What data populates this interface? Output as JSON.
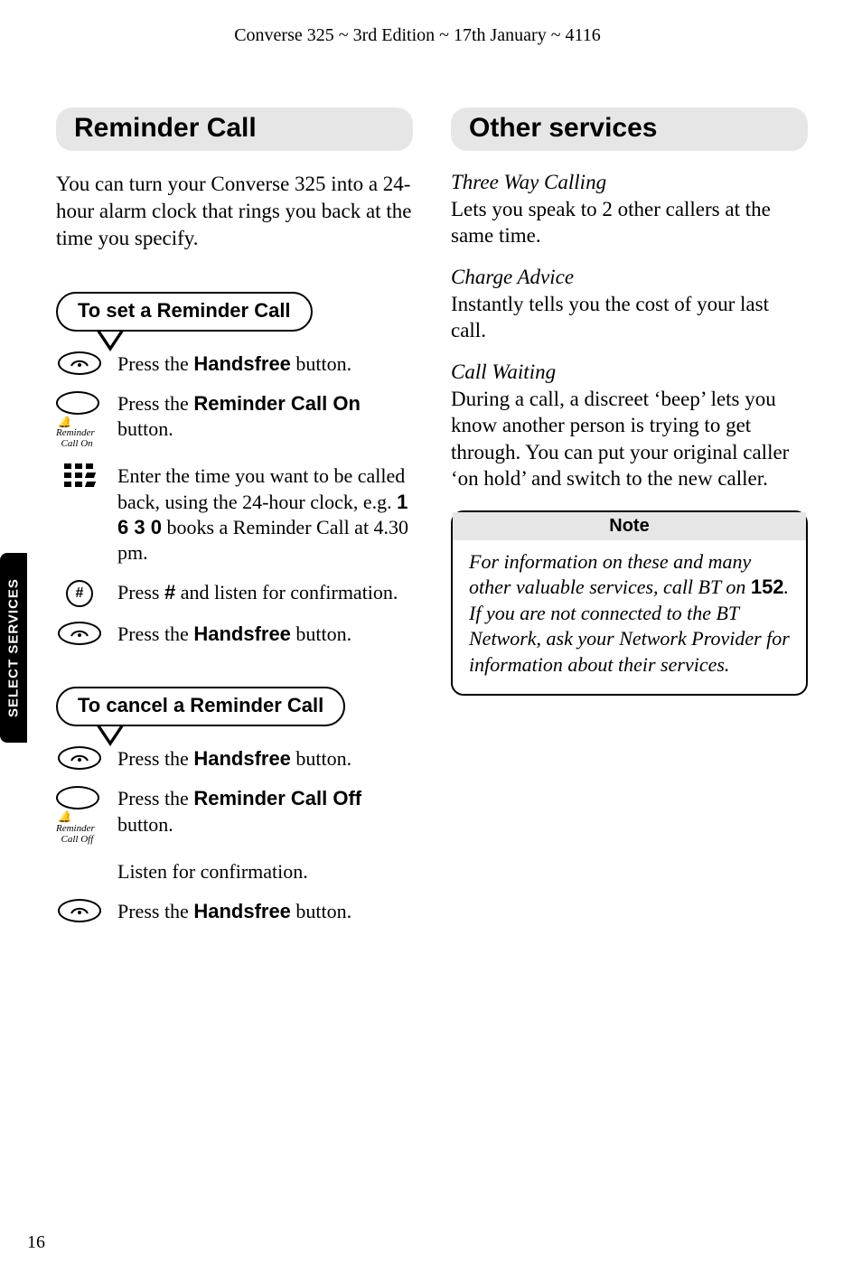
{
  "runningHead": "Converse 325 ~ 3rd Edition ~ 17th January ~ 4116",
  "sideTab": "SELECT SERVICES",
  "pageNumber": "16",
  "left": {
    "heading": "Reminder Call",
    "intro": "You can turn your Converse 325 into a 24-hour alarm clock that rings you back at the time you specify.",
    "set": {
      "title": "To set a Reminder Call",
      "steps": {
        "s1a": "Press the ",
        "s1b": "Handsfree",
        "s1c": " button.",
        "s2a": "Press the ",
        "s2b": "Reminder Call On",
        "s2c": " button.",
        "s3a": "Enter the time you want to be called back, using the 24-hour clock, e.g. ",
        "s3b": "1 6 3 0",
        "s3c": " books a Reminder Call at 4.30 pm.",
        "s4a": "Press ",
        "s4b": "#",
        "s4c": " and listen for confirmation.",
        "s5a": "Press the ",
        "s5b": "Handsfree",
        "s5c": " button."
      },
      "iconLabels": {
        "reminderOn1": "Reminder",
        "reminderOn2": "Call On"
      }
    },
    "cancel": {
      "title": "To cancel a Reminder Call",
      "steps": {
        "c1a": "Press the ",
        "c1b": "Handsfree",
        "c1c": " button.",
        "c2a": "Press the ",
        "c2b": "Reminder Call Off",
        "c2c": " button.",
        "c3": "Listen for confirmation.",
        "c4a": "Press the ",
        "c4b": "Handsfree",
        "c4c": " button."
      },
      "iconLabels": {
        "reminderOff1": "Reminder",
        "reminderOff2": "Call Off"
      }
    }
  },
  "right": {
    "heading": "Other services",
    "services": {
      "twc_title": "Three Way Calling",
      "twc_body": "Lets you speak to 2 other callers at the same time.",
      "ca_title": "Charge Advice",
      "ca_body": "Instantly tells you the cost of your last call.",
      "cw_title": "Call Waiting",
      "cw_body": "During a call, a discreet ‘beep’ lets you know another person is trying to get through. You can put your original caller ‘on hold’ and switch to the new caller."
    },
    "note": {
      "head": "Note",
      "b1": "For information on these and many other valuable services, call BT on ",
      "phone": "152",
      "b2": ". If you are not connected to the BT Network, ask your Network Provider for information about their services."
    }
  }
}
